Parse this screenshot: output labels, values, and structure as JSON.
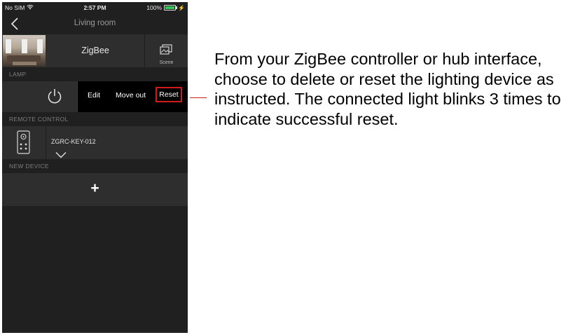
{
  "status_bar": {
    "carrier": "No SIM",
    "time": "2:57 PM",
    "battery": "100%"
  },
  "nav": {
    "title": "Living room"
  },
  "room": {
    "name": "ZigBee",
    "scene_label": "Scene"
  },
  "sections": {
    "lamp": "LAMP",
    "remote_control": "REMOTE CONTROL",
    "new_device": "NEW DEVICE"
  },
  "lamp": {
    "actions": {
      "edit": "Edit",
      "move_out": "Move out",
      "reset": "Reset"
    }
  },
  "remote": {
    "name": "ZGRC-KEY-012"
  },
  "new_device": {
    "add_symbol": "+"
  },
  "instruction": "From your ZigBee controller or hub interface, choose to delete or reset the lighting device as instructed. The connected light blinks 3 times to indicate successful reset.",
  "colors": {
    "app_background": "#202020",
    "row_background": "#2e2e2e",
    "highlight": "#d21a1a",
    "battery": "#34c759"
  }
}
